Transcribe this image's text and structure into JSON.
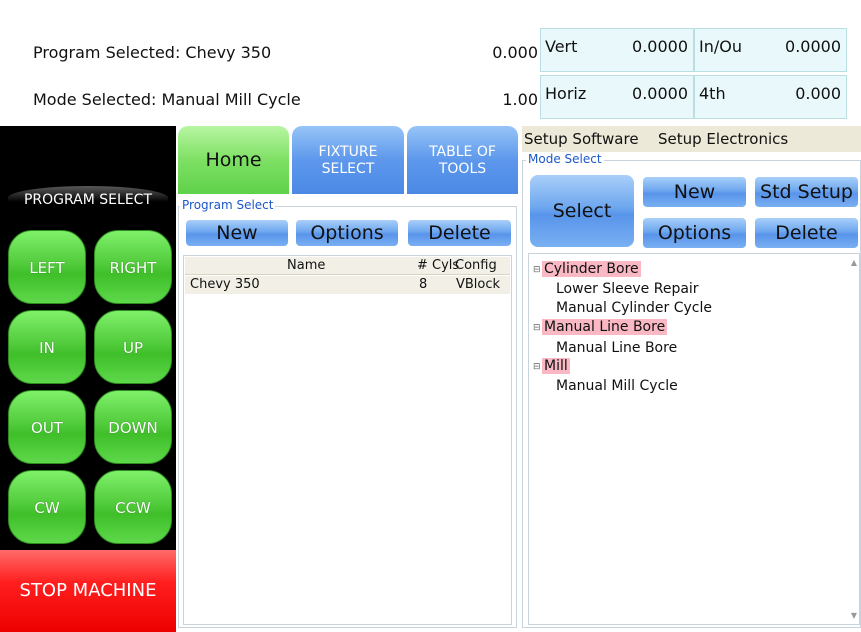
{
  "status": {
    "program_label": "Program Selected: Chevy 350",
    "mode_label": "Mode Selected: Manual Mill Cycle",
    "program_value": "0.000",
    "mode_value": "1.00"
  },
  "axes": [
    {
      "label": "Vert",
      "value": "0.0000"
    },
    {
      "label": "In/Ou",
      "value": "0.0000"
    },
    {
      "label": "Horiz",
      "value": "0.0000"
    },
    {
      "label": "4th",
      "value": "0.000"
    }
  ],
  "left_panel": {
    "title": "PROGRAM SELECT",
    "buttons": [
      "LEFT",
      "RIGHT",
      "IN",
      "UP",
      "OUT",
      "DOWN",
      "CW",
      "CCW"
    ],
    "stop_label": "STOP MACHINE"
  },
  "tabs": {
    "home": "Home",
    "fixture_line1": "FIXTURE",
    "fixture_line2": "SELECT",
    "tools_line1": "TABLE OF",
    "tools_line2": "TOOLS"
  },
  "program_select": {
    "title": "Program Select",
    "new_label": "New",
    "options_label": "Options",
    "delete_label": "Delete",
    "columns": [
      "Name",
      "# Cyls",
      "Config"
    ],
    "rows": [
      {
        "name": "Chevy 350",
        "cyls": "8",
        "config": "VBlock"
      }
    ]
  },
  "setup": {
    "software_tab": "Setup Software",
    "electronics_tab": "Setup Electronics"
  },
  "mode_select": {
    "title": "Mode Select",
    "select_label": "Select",
    "new_label": "New",
    "std_setup_label": "Std Setup",
    "options_label": "Options",
    "delete_label": "Delete",
    "tree": [
      {
        "category": "Cylinder Bore",
        "items": [
          "Lower Sleeve Repair",
          "Manual Cylinder Cycle"
        ]
      },
      {
        "category": "Manual Line Bore",
        "items": [
          "Manual Line Bore"
        ]
      },
      {
        "category": "Mill",
        "items": [
          "Manual Mill Cycle"
        ]
      }
    ]
  },
  "colors": {
    "green_button": "#52cc3c",
    "stop_red": "#ff1e1e",
    "blue_button": "#6ea7ef",
    "category_highlight": "#f9b8c3"
  }
}
